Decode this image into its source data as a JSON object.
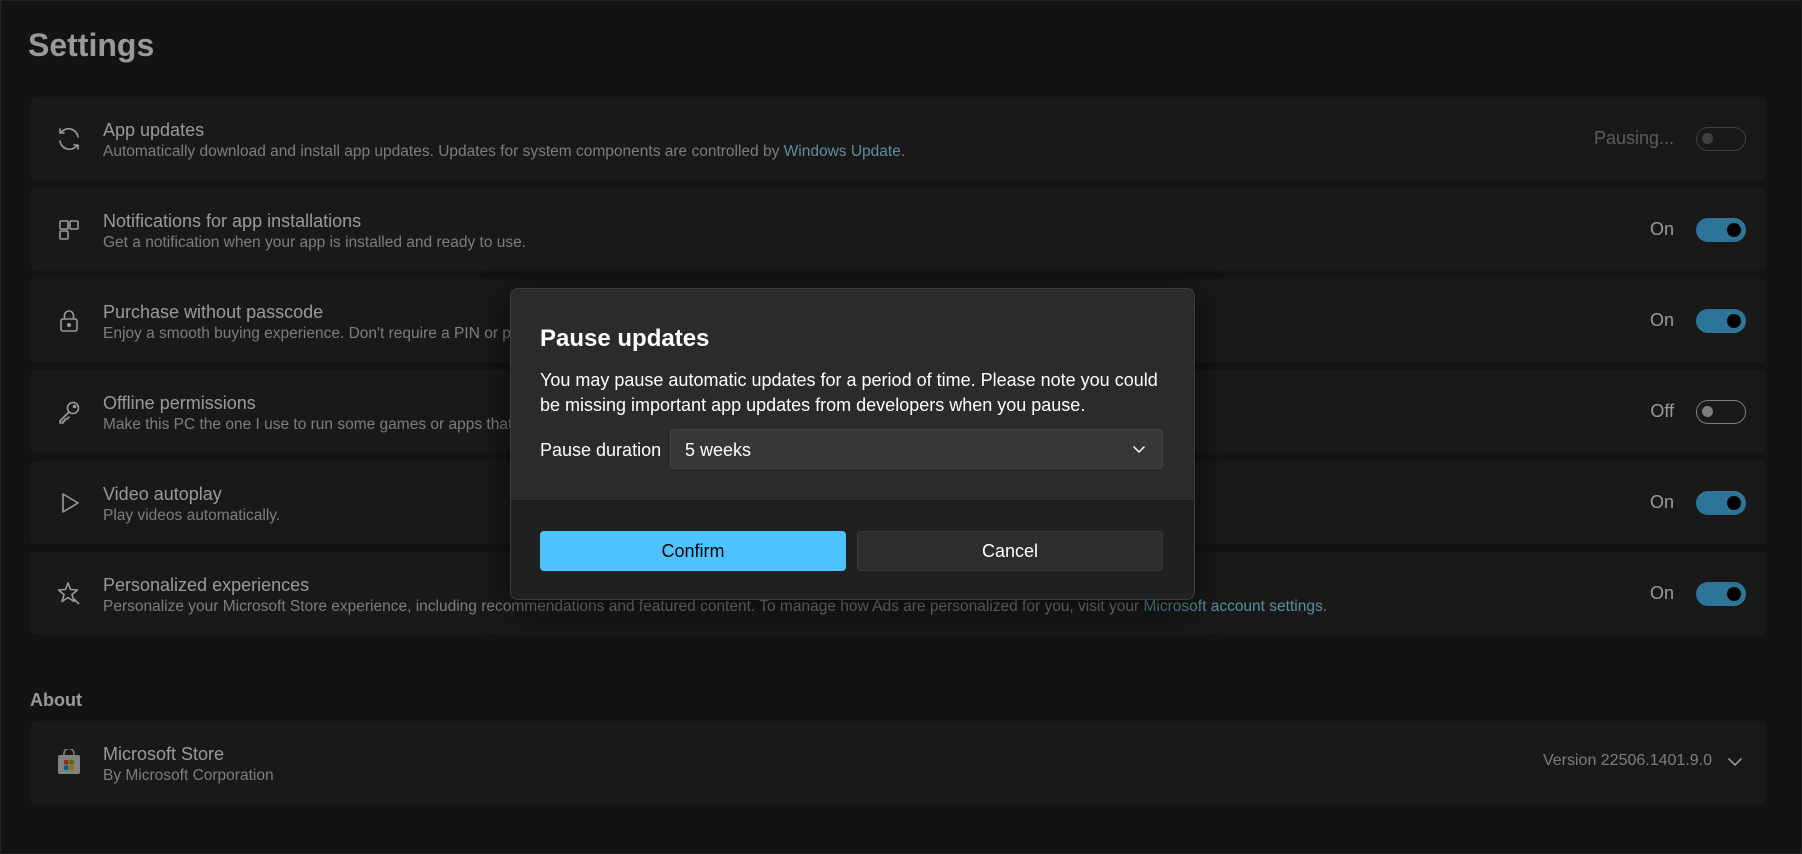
{
  "page": {
    "title": "Settings"
  },
  "settings": [
    {
      "icon": "refresh-icon",
      "title": "App updates",
      "desc": "Automatically download and install app updates. Updates for system components are controlled by ",
      "link": "Windows Update",
      "desc_after": ".",
      "state": "Pausing...",
      "toggle": "disabled"
    },
    {
      "icon": "app-install-icon",
      "title": "Notifications for app installations",
      "desc": "Get a notification when your app is installed and ready to use.",
      "state": "On",
      "toggle": "on"
    },
    {
      "icon": "lock-icon",
      "title": "Purchase without passcode",
      "desc": "Enjoy a smooth buying experience. Don't require a PIN or pa",
      "state": "On",
      "toggle": "on"
    },
    {
      "icon": "key-icon",
      "title": "Offline permissions",
      "desc": "Make this PC the one I use to run some games or apps that h",
      "state": "Off",
      "toggle": "off"
    },
    {
      "icon": "play-icon",
      "title": "Video autoplay",
      "desc": "Play videos automatically.",
      "state": "On",
      "toggle": "on"
    },
    {
      "icon": "sparkle-pen-icon",
      "title": "Personalized experiences",
      "desc": "Personalize your Microsoft Store experience, including recommendations and featured content. To manage how Ads are personalized for you, visit your ",
      "link": "Microsoft account settings",
      "desc_after": ".",
      "state": "On",
      "toggle": "on"
    }
  ],
  "about": {
    "section_title": "About",
    "app_title": "Microsoft Store",
    "publisher": "By Microsoft Corporation",
    "version": "Version 22506.1401.9.0"
  },
  "dialog": {
    "title": "Pause updates",
    "body": "You may pause automatic updates for a period of time. Please note you could be missing important app updates from developers when you pause.",
    "duration_label": "Pause duration",
    "duration_value": "5 weeks",
    "confirm_label": "Confirm",
    "cancel_label": "Cancel"
  },
  "colors": {
    "accent": "#4cc2ff",
    "link": "#99ebff",
    "background": "#202020",
    "card": "#2b2b2b"
  }
}
